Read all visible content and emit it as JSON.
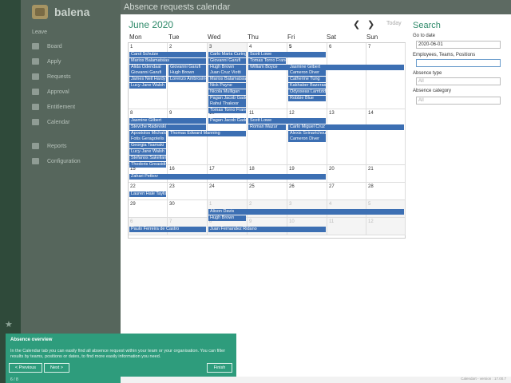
{
  "brand": {
    "name": "balena"
  },
  "sidebar": {
    "section_label": "Leave",
    "items": [
      {
        "label": "Board",
        "icon": "board-icon"
      },
      {
        "label": "Apply",
        "icon": "apply-icon"
      },
      {
        "label": "Requests",
        "icon": "requests-icon"
      },
      {
        "label": "Approval",
        "icon": "approval-icon"
      },
      {
        "label": "Entitlement",
        "icon": "entitlement-icon"
      },
      {
        "label": "Calendar",
        "icon": "calendar-icon"
      },
      {
        "label": "Reports",
        "icon": "reports-icon"
      },
      {
        "label": "Configuration",
        "icon": "configuration-icon"
      }
    ],
    "star": "★"
  },
  "header": {
    "title": "Absence requests calendar"
  },
  "calendar": {
    "month_title": "June 2020",
    "prev": "❮",
    "next": "❯",
    "today": "Today",
    "weekdays": [
      "Mon",
      "Tue",
      "Wed",
      "Thu",
      "Fri",
      "Sat",
      "Sun"
    ],
    "weeks": [
      [
        "1",
        "2",
        "3",
        "4",
        "5",
        "6",
        "7"
      ],
      [
        "8",
        "9",
        "10",
        "11",
        "12",
        "13",
        "14"
      ],
      [
        "15",
        "16",
        "17",
        "18",
        "19",
        "20",
        "21"
      ],
      [
        "22",
        "23",
        "24",
        "25",
        "26",
        "27",
        "28"
      ],
      [
        "29",
        "30",
        "1",
        "2",
        "3",
        "4",
        "5"
      ],
      [
        "6",
        "7",
        "8",
        "9",
        "10",
        "11",
        "12"
      ]
    ],
    "events": [
      {
        "label": "Carol Schulze",
        "week": 0,
        "start": 0,
        "span": 2,
        "row": 0
      },
      {
        "label": "Marios Balamatsias",
        "week": 0,
        "start": 0,
        "span": 2,
        "row": 1
      },
      {
        "label": "Alida Odendaal",
        "week": 0,
        "start": 0,
        "span": 1,
        "row": 2
      },
      {
        "label": "Giovanni Garufi",
        "week": 0,
        "start": 0,
        "span": 1,
        "row": 3
      },
      {
        "label": "James Neil Hardy",
        "week": 0,
        "start": 0,
        "span": 1,
        "row": 4
      },
      {
        "label": "Lucy-Jane Walsh",
        "week": 0,
        "start": 0,
        "span": 1,
        "row": 5
      },
      {
        "label": "Giovanni Garufi",
        "week": 0,
        "start": 1,
        "span": 1,
        "row": 2
      },
      {
        "label": "Hugh Brown",
        "week": 0,
        "start": 1,
        "span": 1,
        "row": 3
      },
      {
        "label": "Lorenzo Ambrosino",
        "week": 0,
        "start": 1,
        "span": 1,
        "row": 4
      },
      {
        "label": "Carlo Maria Curinga",
        "week": 0,
        "start": 2,
        "span": 1,
        "row": 0
      },
      {
        "label": "Giovanni Garufi",
        "week": 0,
        "start": 2,
        "span": 1,
        "row": 1
      },
      {
        "label": "Hugh Brown",
        "week": 0,
        "start": 2,
        "span": 1,
        "row": 2
      },
      {
        "label": "Juan Cruz Viotti",
        "week": 0,
        "start": 2,
        "span": 1,
        "row": 3
      },
      {
        "label": "Marios Balamatsias",
        "week": 0,
        "start": 2,
        "span": 1,
        "row": 4
      },
      {
        "label": "Nick Payne",
        "week": 0,
        "start": 2,
        "span": 1,
        "row": 5
      },
      {
        "label": "Nicola Mulligan",
        "week": 0,
        "start": 2,
        "span": 1,
        "row": 6
      },
      {
        "label": "Pagan Jacob Gadd",
        "week": 0,
        "start": 2,
        "span": 1,
        "row": 7
      },
      {
        "label": "Rahul Thakoor",
        "week": 0,
        "start": 2,
        "span": 1,
        "row": 8
      },
      {
        "label": "Tomas Torno Franco",
        "week": 0,
        "start": 2,
        "span": 1,
        "row": 9
      },
      {
        "label": "Scott Lowe",
        "week": 0,
        "start": 3,
        "span": 2,
        "row": 0
      },
      {
        "label": "Tomas Torno Franco",
        "week": 0,
        "start": 3,
        "span": 1,
        "row": 1
      },
      {
        "label": "William Boyce",
        "week": 0,
        "start": 3,
        "span": 4,
        "row": 2
      },
      {
        "label": "Jasmine Gilbert",
        "week": 0,
        "start": 4,
        "span": 1,
        "row": 2
      },
      {
        "label": "Cameron Diver",
        "week": 0,
        "start": 4,
        "span": 1,
        "row": 3
      },
      {
        "label": "Catherine Tung",
        "week": 0,
        "start": 4,
        "span": 1,
        "row": 4
      },
      {
        "label": "Kakhaber Bazerashvili",
        "week": 0,
        "start": 4,
        "span": 1,
        "row": 5
      },
      {
        "label": "Odysseas Lamtzidis",
        "week": 0,
        "start": 4,
        "span": 1,
        "row": 6
      },
      {
        "label": "Robbie Blue",
        "week": 0,
        "start": 4,
        "span": 1,
        "row": 7
      },
      {
        "label": "Jasmine Gilbert",
        "week": 1,
        "start": 0,
        "span": 2,
        "row": 0
      },
      {
        "label": "Pagan Jacob Gadd",
        "week": 1,
        "start": 2,
        "span": 1,
        "row": 0
      },
      {
        "label": "Scott Lowe",
        "week": 1,
        "start": 3,
        "span": 2,
        "row": 0
      },
      {
        "label": "Stevche Radevski",
        "week": 1,
        "start": 0,
        "span": 2,
        "row": 1
      },
      {
        "label": "Roman Mazur",
        "week": 1,
        "start": 3,
        "span": 1,
        "row": 1
      },
      {
        "label": "Carlo Miguel Cruz",
        "week": 1,
        "start": 4,
        "span": 3,
        "row": 1
      },
      {
        "label": "Apostolos Michalopoulos",
        "week": 1,
        "start": 0,
        "span": 1,
        "row": 2
      },
      {
        "label": "Thomas Edward Manning",
        "week": 1,
        "start": 1,
        "span": 2,
        "row": 2
      },
      {
        "label": "Alexis Svinartchouk",
        "week": 1,
        "start": 4,
        "span": 1,
        "row": 2
      },
      {
        "label": "Fotis Geragotelis",
        "week": 1,
        "start": 0,
        "span": 1,
        "row": 3
      },
      {
        "label": "Cameron Diver",
        "week": 1,
        "start": 4,
        "span": 1,
        "row": 3
      },
      {
        "label": "Georgia Tsamaki",
        "week": 1,
        "start": 0,
        "span": 1,
        "row": 4
      },
      {
        "label": "Lucy-Jane Walsh",
        "week": 1,
        "start": 0,
        "span": 1,
        "row": 5
      },
      {
        "label": "Stefanos Sakellaris",
        "week": 1,
        "start": 0,
        "span": 1,
        "row": 6
      },
      {
        "label": "Thodoris Greasidis",
        "week": 1,
        "start": 0,
        "span": 1,
        "row": 7
      },
      {
        "label": "Zahari Petkov",
        "week": 2,
        "start": 0,
        "span": 5,
        "row": 0
      },
      {
        "label": "Lauren Hale Taylor",
        "week": 3,
        "start": 0,
        "span": 1,
        "row": 0
      },
      {
        "label": "Alison Davis",
        "week": 4,
        "start": 2,
        "span": 5,
        "row": 0
      },
      {
        "label": "Hugh Brown",
        "week": 4,
        "start": 2,
        "span": 1,
        "row": 1
      },
      {
        "label": "Paulo Ferreira de Castro",
        "week": 5,
        "start": 0,
        "span": 2,
        "row": 0
      },
      {
        "label": "Juan Fernandez Ridano",
        "week": 5,
        "start": 2,
        "span": 3,
        "row": 0
      }
    ]
  },
  "search": {
    "title": "Search",
    "go_to_date_label": "Go to date",
    "go_to_date_value": "2020-06-01",
    "employees_label": "Employees, Teams, Positions",
    "employees_value": "",
    "absence_type_label": "Absence type",
    "absence_type_placeholder": "All",
    "absence_category_label": "Absence category",
    "absence_category_placeholder": "All"
  },
  "overlay": {
    "title": "Absence overview",
    "text": "In the Calendar tab you can easily find all absence request within your team or your organisation. You can filter results by teams, positions or dates, to find more easily information you need.",
    "previous": "< Previous",
    "next": "Next >",
    "finish": "Finish",
    "step": "6 / 8"
  },
  "footer": {
    "version": "Calendart - version : 17.00.7"
  },
  "colors": {
    "accent": "#2f8a6a",
    "event": "#3c6fb3",
    "sidebar": "#56665c",
    "overlay": "#2e9c7c"
  }
}
